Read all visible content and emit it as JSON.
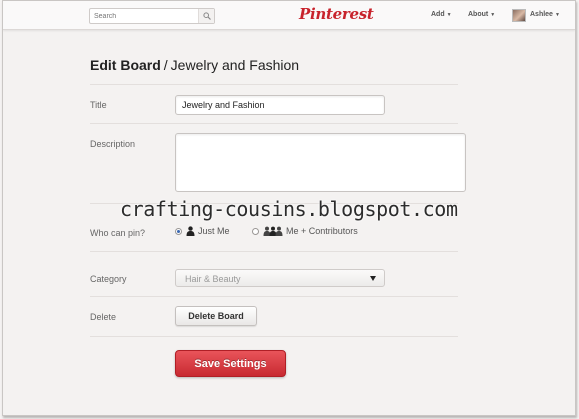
{
  "header": {
    "search_placeholder": "Search",
    "logo_text": "Pinterest",
    "add_label": "Add",
    "about_label": "About",
    "user_name": "Ashlee",
    "caret": "▼"
  },
  "page": {
    "title_bold": "Edit Board",
    "title_separator": "/",
    "title_board": "Jewelry and Fashion"
  },
  "form": {
    "title_label": "Title",
    "title_value": "Jewelry and Fashion",
    "description_label": "Description",
    "description_value": "",
    "who_can_pin_label": "Who can pin?",
    "option_just_me": "Just Me",
    "option_contributors": "Me + Contributors",
    "selected_option": "Just Me",
    "category_label": "Category",
    "category_value": "Hair & Beauty",
    "delete_label": "Delete",
    "delete_button": "Delete Board",
    "save_button": "Save Settings"
  },
  "watermark": "crafting-cousins.blogspot.com",
  "colors": {
    "brand_red": "#c8232c",
    "save_button": "#d8383f",
    "radio_selected": "#3a67b0"
  }
}
